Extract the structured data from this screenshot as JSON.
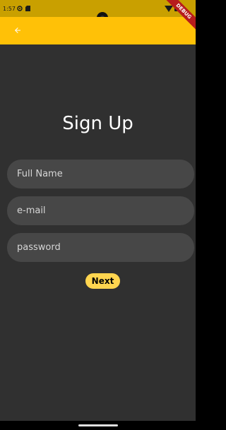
{
  "status_bar": {
    "time": "1:57",
    "icons": [
      "sync-icon",
      "sd-card-icon",
      "wifi-icon",
      "battery-icon"
    ]
  },
  "debug_banner": "DEBUG",
  "app_bar": {
    "background_color": "#ffc107",
    "back_icon": "arrow-back-icon"
  },
  "title": "Sign Up",
  "form": {
    "full_name": {
      "placeholder": "Full Name",
      "value": ""
    },
    "email": {
      "placeholder": "e-mail",
      "value": ""
    },
    "password": {
      "placeholder": "password",
      "value": ""
    }
  },
  "next_button": {
    "label": "Next",
    "color": "#ffd54f"
  }
}
